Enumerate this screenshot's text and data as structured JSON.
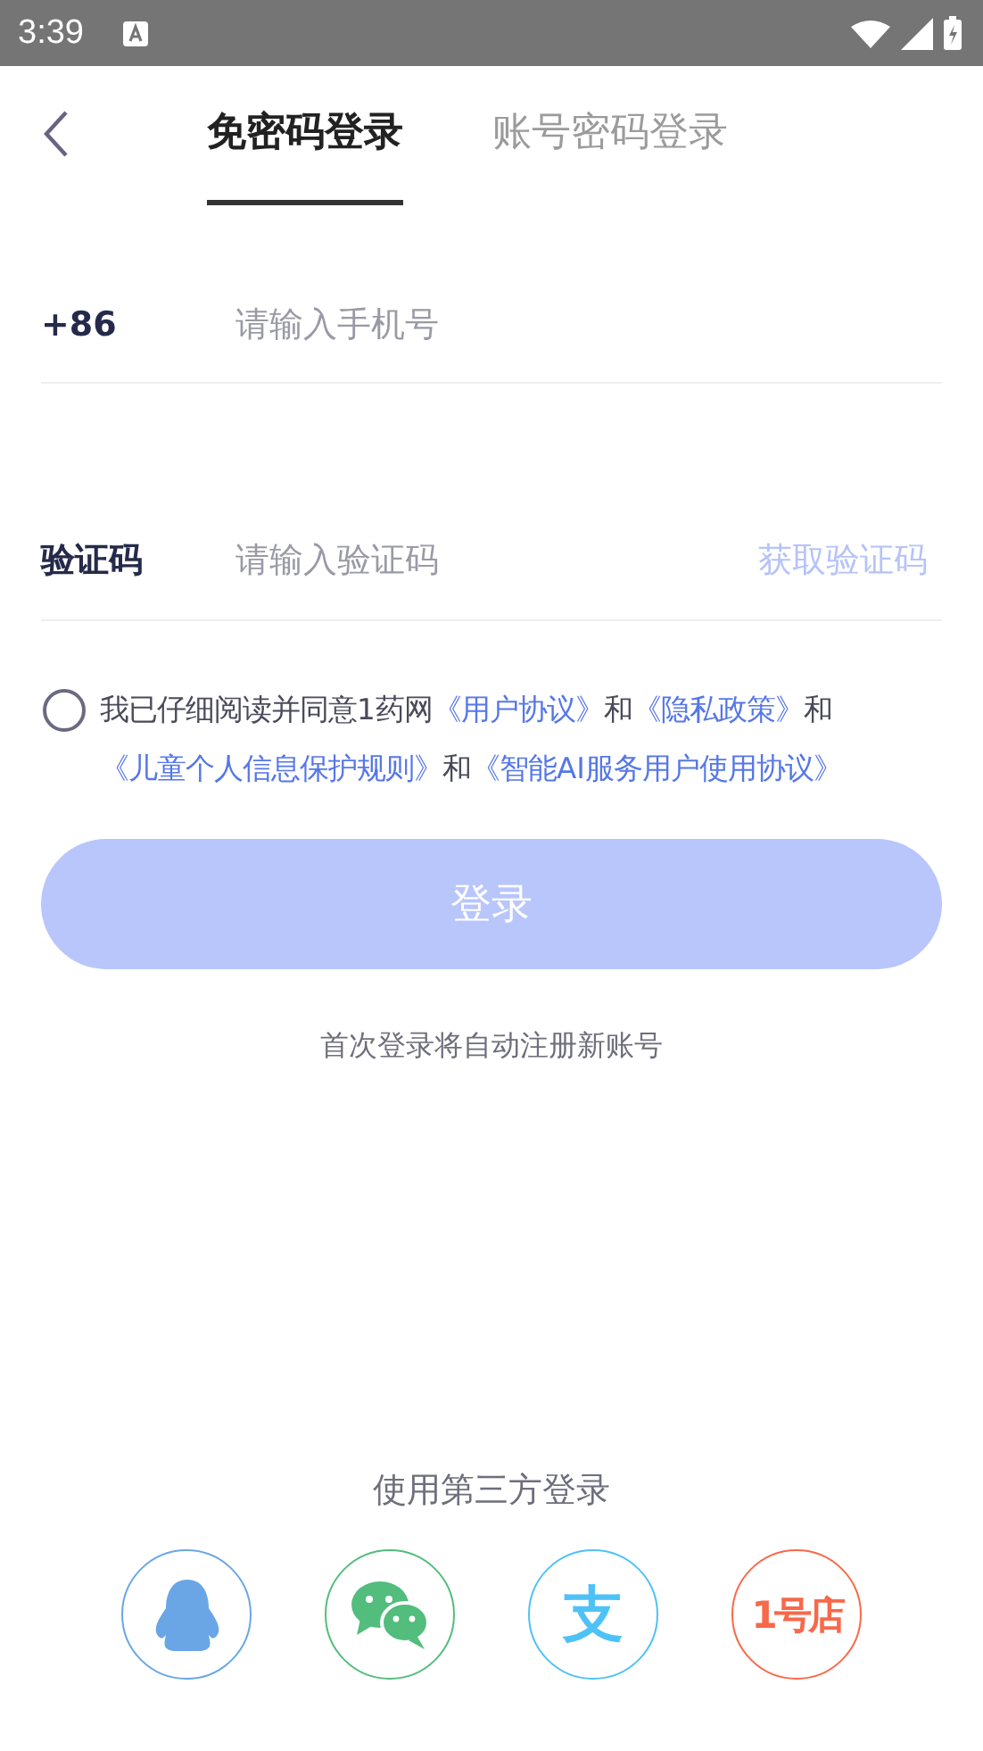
{
  "status_bar": {
    "time": "3:39"
  },
  "tabs": [
    {
      "label": "免密码登录",
      "selected": true
    },
    {
      "label": "账号密码登录",
      "selected": false
    }
  ],
  "phone_field": {
    "prefix": "+86",
    "placeholder": "请输入手机号"
  },
  "code_field": {
    "label": "验证码",
    "placeholder": "请输入验证码",
    "action": "获取验证码",
    "action_disabled": true
  },
  "agreement": {
    "checked": false,
    "parts": [
      {
        "kind": "text",
        "text": "我已仔细阅读并同意1药网"
      },
      {
        "kind": "link",
        "text": "《用户协议》"
      },
      {
        "kind": "text",
        "text": "和"
      },
      {
        "kind": "link",
        "text": "《隐私政策》"
      },
      {
        "kind": "text",
        "text": "和"
      },
      {
        "kind": "link",
        "text": "《儿童个人信息保护规则》"
      },
      {
        "kind": "text",
        "text": "和"
      },
      {
        "kind": "link",
        "text": "《智能AI服务用户使用协议》"
      }
    ]
  },
  "login_button": {
    "label": "登录",
    "disabled": true
  },
  "hint": "首次登录将自动注册新账号",
  "third_party": {
    "title": "使用第三方登录",
    "providers": [
      {
        "kind": "penguin",
        "color": "#6aa6e6"
      },
      {
        "kind": "chat",
        "color": "#52bd7c"
      },
      {
        "kind": "glyph",
        "text": "支",
        "color": "#4ec2f7"
      },
      {
        "kind": "glyph",
        "text": "1号店",
        "color": "#f7694a"
      }
    ]
  }
}
